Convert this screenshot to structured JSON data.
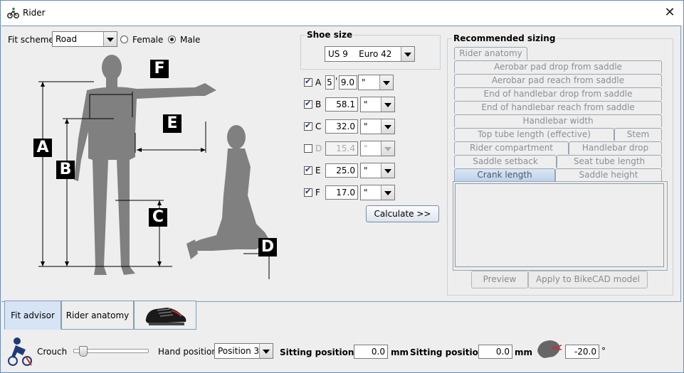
{
  "window": {
    "title": "Rider"
  },
  "fit": {
    "scheme_label": "Fit scheme",
    "scheme_value": "Road",
    "female_label": "Female",
    "male_label": "Male"
  },
  "diagram_labels": {
    "a": "A",
    "b": "B",
    "c": "C",
    "d": "D",
    "e": "E",
    "f": "F"
  },
  "shoe": {
    "label": "Shoe size",
    "value": "US 9    Euro 42"
  },
  "measurements": [
    {
      "letter": "A",
      "checked": true,
      "feet": "5",
      "feet_mark": "'",
      "value": "9.0",
      "unit": "\"",
      "enabled": true
    },
    {
      "letter": "B",
      "checked": true,
      "value": "58.1",
      "unit": "\"",
      "enabled": true
    },
    {
      "letter": "C",
      "checked": true,
      "value": "32.0",
      "unit": "\"",
      "enabled": true
    },
    {
      "letter": "D",
      "checked": false,
      "value": "15.4",
      "unit": "\"",
      "enabled": false
    },
    {
      "letter": "E",
      "checked": true,
      "value": "25.0",
      "unit": "\"",
      "enabled": true
    },
    {
      "letter": "F",
      "checked": true,
      "value": "17.0",
      "unit": "\"",
      "enabled": true
    }
  ],
  "calculate_label": "Calculate >>",
  "recommended": {
    "title": "Recommended sizing",
    "tabs_row1": [
      "Rider anatomy"
    ],
    "tabs_full": [
      "Aerobar pad drop from saddle",
      "Aerobar pad reach from saddle",
      "End of handlebar drop from saddle",
      "End of handlebar reach from saddle",
      "Handlebar width"
    ],
    "tab_top_tube": "Top tube length (effective)",
    "tab_stem": "Stem",
    "tab_rider_compartment": "Rider compartment",
    "tab_handlebar_drop": "Handlebar drop",
    "tab_saddle_setback": "Saddle setback",
    "tab_seat_tube": "Seat tube length",
    "tab_crank": "Crank length",
    "tab_saddle_height": "Saddle height",
    "preview_label": "Preview",
    "apply_label": "Apply to BikeCAD model"
  },
  "bottom_tabs": [
    "Fit advisor",
    "Rider anatomy"
  ],
  "bottom": {
    "crouch_label": "Crouch",
    "crouch_level": 0.08,
    "hand_position_label": "Hand position",
    "hand_position_value": "Position 3",
    "sitting_h_label": "Sitting position ↔",
    "sitting_h_value": "0.0",
    "sitting_h_unit": "mm",
    "sitting_v_label": "Sitting position ↕",
    "sitting_v_value": "0.0",
    "sitting_v_unit": "mm",
    "angle_value": "-20.0",
    "angle_unit": "°"
  },
  "colors": {
    "accent": "#1f3a78",
    "selected_tab": "#d6e4f5",
    "silhouette": "#808080"
  }
}
